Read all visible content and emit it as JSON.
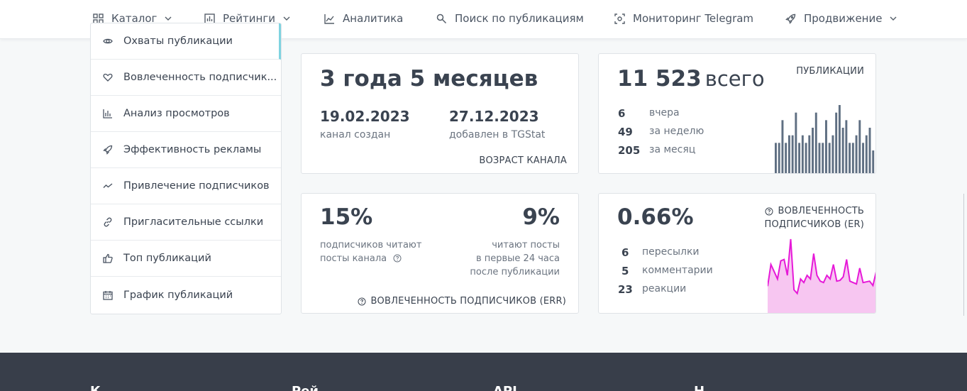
{
  "nav": [
    {
      "label": "Каталог",
      "icon": "grid-icon",
      "dropdown": true
    },
    {
      "label": "Рейтинги",
      "icon": "bar-chart-icon",
      "dropdown": true
    },
    {
      "label": "Аналитика",
      "icon": "line-chart-icon",
      "dropdown": false
    },
    {
      "label": "Поиск по публикациям",
      "icon": "search-icon",
      "dropdown": false
    },
    {
      "label": "Мониторинг Telegram",
      "icon": "scan-icon",
      "dropdown": false
    },
    {
      "label": "Продвижение",
      "icon": "rocket-icon",
      "dropdown": true
    }
  ],
  "sidebar": {
    "items": [
      {
        "label": "Охваты публикации",
        "icon": "eye-icon"
      },
      {
        "label": "Вовлеченность подписчик...",
        "icon": "heart-icon"
      },
      {
        "label": "Анализ просмотров",
        "icon": "bar-chart-icon"
      },
      {
        "label": "Эффективность рекламы",
        "icon": "rocket-icon"
      },
      {
        "label": "Привлечение подписчиков",
        "icon": "trend-icon"
      },
      {
        "label": "Пригласительные ссылки",
        "icon": "link-icon"
      },
      {
        "label": "Топ публикаций",
        "icon": "thumbs-up-icon"
      },
      {
        "label": "График публикаций",
        "icon": "calendar-icon"
      }
    ]
  },
  "age_card": {
    "value": "3 года 5 месяцев",
    "created_date": "19.02.2023",
    "created_label": "канал создан",
    "added_date": "27.12.2023",
    "added_label": "добавлен в TGStat",
    "caption": "ВОЗРАСТ КАНАЛА"
  },
  "posts_card": {
    "total": "11 523",
    "total_suffix": "всего",
    "caption": "ПУБЛИКАЦИИ",
    "rows": [
      {
        "value": "6",
        "label": "вчера"
      },
      {
        "value": "49",
        "label": "за неделю"
      },
      {
        "value": "205",
        "label": "за месяц"
      }
    ],
    "bars": [
      4,
      4,
      7,
      4,
      5,
      5,
      8,
      4,
      5,
      4,
      5,
      6,
      8,
      4,
      4,
      7,
      4,
      5,
      8,
      9,
      6,
      7,
      4,
      4,
      5,
      7,
      4,
      5,
      6,
      3
    ],
    "bar_color": "#5f6f82"
  },
  "err_card": {
    "left_value": "15%",
    "left_label_1": "подписчиков читают",
    "left_label_2": "посты канала",
    "right_value": "9%",
    "right_label_1": "читают посты",
    "right_label_2": "в первые 24 часа",
    "right_label_3": "после публикации",
    "caption": "ВОВЛЕЧЕННОСТЬ ПОДПИСЧИКОВ (ERR)"
  },
  "er_card": {
    "value": "0.66%",
    "caption_1": "ВОВЛЕЧЕННОСТЬ",
    "caption_2": "ПОДПИСЧИКОВ (ER)",
    "rows": [
      {
        "value": "6",
        "label": "пересылки"
      },
      {
        "value": "5",
        "label": "комментарии"
      },
      {
        "value": "23",
        "label": "реакции"
      }
    ],
    "line": [
      0.35,
      0.65,
      0.55,
      0.45,
      0.7,
      0.72,
      0.5,
      1.0,
      0.3,
      0.25,
      0.45,
      0.4,
      0.5,
      0.45,
      0.8,
      0.5,
      0.42,
      0.4,
      0.5,
      0.45,
      0.65,
      0.42,
      0.43,
      0.48,
      0.72,
      0.42,
      0.4,
      0.38,
      0.6,
      0.4,
      0.41,
      0.42,
      0.36,
      0.55
    ],
    "line_color": "#e619d8"
  },
  "footer": {
    "cols": [
      "К",
      "Рей",
      "API",
      "Н"
    ]
  }
}
